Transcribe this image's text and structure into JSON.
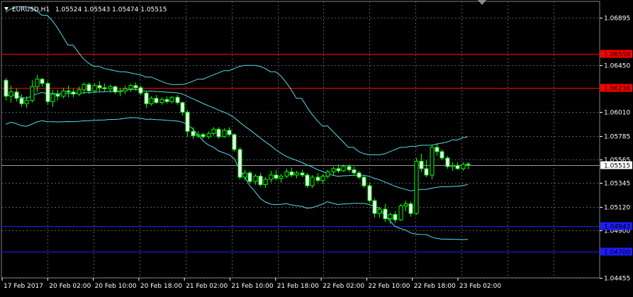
{
  "header": {
    "symbol_timeframe": "EURUSD,H1",
    "ohlc": "1.05524 1.05543 1.05474 1.05515",
    "menu_icon": "triangle-down-icon"
  },
  "price_axis": {
    "labels": [
      "1.06895",
      "1.06450",
      "1.06010",
      "1.05785",
      "1.05565",
      "1.05345",
      "1.05120",
      "1.04900",
      "1.04455"
    ],
    "values": [
      1.06895,
      1.0645,
      1.0601,
      1.05785,
      1.05565,
      1.05345,
      1.0512,
      1.049,
      1.04455
    ]
  },
  "time_axis": {
    "labels": [
      "17 Feb 2017",
      "20 Feb 02:00",
      "20 Feb 10:00",
      "20 Feb 18:00",
      "21 Feb 02:00",
      "21 Feb 10:00",
      "21 Feb 18:00",
      "22 Feb 02:00",
      "22 Feb 10:00",
      "22 Feb 18:00",
      "23 Feb 02:00"
    ]
  },
  "level_lines": [
    {
      "price": 1.06558,
      "label": "1.06558",
      "color": "#ff0000"
    },
    {
      "price": 1.06236,
      "label": "1.06236",
      "color": "#ff0000"
    },
    {
      "price": 1.04943,
      "label": "1.04943",
      "color": "#1c1cff"
    },
    {
      "price": 1.047,
      "label": "1.04700",
      "color": "#1c1cff"
    }
  ],
  "current_price": {
    "price": 1.05515,
    "label": "1.05515",
    "color": "#ffffff"
  },
  "colors": {
    "background": "#000000",
    "grid": "#5a5a5a",
    "candle_bull": "#000000",
    "candle_outline": "#00ff00",
    "bands": "#5ad8e8",
    "axis_text": "#ffffff"
  },
  "chart_data": {
    "type": "candlestick",
    "title": "EURUSD,H1",
    "y_range": [
      1.04455,
      1.0705
    ],
    "bollinger_bands": true,
    "grid": true,
    "candles": [
      [
        1.0631,
        1.0633,
        1.0612,
        1.0616
      ],
      [
        1.0616,
        1.0626,
        1.061,
        1.062
      ],
      [
        1.062,
        1.0623,
        1.0611,
        1.0614
      ],
      [
        1.0614,
        1.0618,
        1.0606,
        1.0609
      ],
      [
        1.0609,
        1.0616,
        1.0605,
        1.0612
      ],
      [
        1.0612,
        1.0631,
        1.061,
        1.0625
      ],
      [
        1.0625,
        1.0636,
        1.062,
        1.0632
      ],
      [
        1.0632,
        1.0633,
        1.0625,
        1.0628
      ],
      [
        1.0628,
        1.063,
        1.0608,
        1.0611
      ],
      [
        1.0611,
        1.0622,
        1.0606,
        1.0618
      ],
      [
        1.0618,
        1.0622,
        1.0612,
        1.0616
      ],
      [
        1.0616,
        1.0624,
        1.0614,
        1.0621
      ],
      [
        1.0621,
        1.0626,
        1.0615,
        1.062
      ],
      [
        1.062,
        1.0623,
        1.0615,
        1.0618
      ],
      [
        1.0618,
        1.0625,
        1.0616,
        1.0622
      ],
      [
        1.0622,
        1.0629,
        1.0618,
        1.0627
      ],
      [
        1.0627,
        1.0629,
        1.0618,
        1.0621
      ],
      [
        1.0621,
        1.0628,
        1.0619,
        1.0626
      ],
      [
        1.0626,
        1.063,
        1.062,
        1.0624
      ],
      [
        1.0624,
        1.0628,
        1.062,
        1.0623
      ],
      [
        1.0623,
        1.0627,
        1.0619,
        1.0625
      ],
      [
        1.0625,
        1.0626,
        1.0618,
        1.062
      ],
      [
        1.062,
        1.0624,
        1.0616,
        1.0621
      ],
      [
        1.0621,
        1.0626,
        1.0618,
        1.0623
      ],
      [
        1.0623,
        1.0628,
        1.062,
        1.0626
      ],
      [
        1.0626,
        1.0629,
        1.0621,
        1.0624
      ],
      [
        1.0624,
        1.0626,
        1.0617,
        1.0619
      ],
      [
        1.0619,
        1.0621,
        1.0605,
        1.0609
      ],
      [
        1.0609,
        1.0616,
        1.0607,
        1.0614
      ],
      [
        1.0614,
        1.0617,
        1.0609,
        1.061
      ],
      [
        1.061,
        1.0615,
        1.0608,
        1.0613
      ],
      [
        1.0613,
        1.0616,
        1.0609,
        1.0611
      ],
      [
        1.0611,
        1.0616,
        1.0609,
        1.0615
      ],
      [
        1.0615,
        1.0617,
        1.0608,
        1.061
      ],
      [
        1.061,
        1.0611,
        1.0598,
        1.0601
      ],
      [
        1.0601,
        1.0603,
        1.0578,
        1.0583
      ],
      [
        1.0583,
        1.0587,
        1.0576,
        1.0579
      ],
      [
        1.0579,
        1.0583,
        1.0577,
        1.058
      ],
      [
        1.058,
        1.0582,
        1.0576,
        1.0578
      ],
      [
        1.0578,
        1.0583,
        1.0576,
        1.0581
      ],
      [
        1.0581,
        1.0587,
        1.0579,
        1.0585
      ],
      [
        1.0585,
        1.0587,
        1.0576,
        1.0578
      ],
      [
        1.0578,
        1.0586,
        1.0577,
        1.0584
      ],
      [
        1.0584,
        1.0587,
        1.0578,
        1.058
      ],
      [
        1.058,
        1.0581,
        1.0564,
        1.0566
      ],
      [
        1.0566,
        1.0568,
        1.0538,
        1.054
      ],
      [
        1.054,
        1.0547,
        1.0537,
        1.0544
      ],
      [
        1.0544,
        1.0546,
        1.0534,
        1.0536
      ],
      [
        1.0536,
        1.0543,
        1.0533,
        1.0541
      ],
      [
        1.0541,
        1.0544,
        1.0531,
        1.0533
      ],
      [
        1.0533,
        1.054,
        1.053,
        1.0538
      ],
      [
        1.0538,
        1.0546,
        1.0535,
        1.0542
      ],
      [
        1.0542,
        1.0547,
        1.0537,
        1.0539
      ],
      [
        1.0539,
        1.0543,
        1.0535,
        1.0541
      ],
      [
        1.0541,
        1.0548,
        1.0539,
        1.0545
      ],
      [
        1.0545,
        1.0549,
        1.054,
        1.0542
      ],
      [
        1.0542,
        1.0546,
        1.0539,
        1.0544
      ],
      [
        1.0544,
        1.0547,
        1.054,
        1.0542
      ],
      [
        1.0542,
        1.0544,
        1.053,
        1.0532
      ],
      [
        1.0532,
        1.0542,
        1.053,
        1.054
      ],
      [
        1.054,
        1.0544,
        1.0535,
        1.0537
      ],
      [
        1.0537,
        1.0543,
        1.0534,
        1.0541
      ],
      [
        1.0541,
        1.0547,
        1.0539,
        1.0545
      ],
      [
        1.0545,
        1.055,
        1.0542,
        1.0548
      ],
      [
        1.0548,
        1.0552,
        1.0544,
        1.0546
      ],
      [
        1.0546,
        1.0552,
        1.0545,
        1.055
      ],
      [
        1.055,
        1.0552,
        1.0545,
        1.0547
      ],
      [
        1.0547,
        1.055,
        1.0542,
        1.0544
      ],
      [
        1.0544,
        1.0546,
        1.0538,
        1.054
      ],
      [
        1.054,
        1.0542,
        1.053,
        1.0532
      ],
      [
        1.0532,
        1.0534,
        1.0516,
        1.0518
      ],
      [
        1.0518,
        1.052,
        1.0502,
        1.0506
      ],
      [
        1.0506,
        1.0512,
        1.0502,
        1.051
      ],
      [
        1.051,
        1.0515,
        1.0498,
        1.0501
      ],
      [
        1.0501,
        1.0507,
        1.0496,
        1.0505
      ],
      [
        1.0505,
        1.0508,
        1.0497,
        1.05
      ],
      [
        1.05,
        1.0515,
        1.0499,
        1.0513
      ],
      [
        1.0513,
        1.0518,
        1.0508,
        1.0515
      ],
      [
        1.0515,
        1.0517,
        1.0503,
        1.0506
      ],
      [
        1.0506,
        1.0558,
        1.0505,
        1.0555
      ],
      [
        1.0555,
        1.0562,
        1.0545,
        1.0548
      ],
      [
        1.0548,
        1.0556,
        1.054,
        1.0542
      ],
      [
        1.0542,
        1.057,
        1.0538,
        1.0568
      ],
      [
        1.0568,
        1.0572,
        1.056,
        1.0564
      ],
      [
        1.0564,
        1.0566,
        1.0556,
        1.0558
      ],
      [
        1.0558,
        1.056,
        1.0548,
        1.055
      ],
      [
        1.055,
        1.0554,
        1.0546,
        1.0551
      ],
      [
        1.0551,
        1.0554,
        1.0547,
        1.0548
      ],
      [
        1.0548,
        1.0554,
        1.0546,
        1.0552
      ],
      [
        1.05524,
        1.05543,
        1.05474,
        1.05515
      ]
    ],
    "upper_band": [
      1.0695,
      1.0698,
      1.07,
      1.07,
      1.0699,
      1.0696,
      1.0692,
      1.0687,
      1.068,
      1.0672,
      1.0664,
      1.0657,
      1.0651,
      1.0647,
      1.0644,
      1.0642,
      1.0641,
      1.064,
      1.0639,
      1.0638,
      1.0637,
      1.0636,
      1.0634,
      1.0632,
      1.063,
      1.0628,
      1.0627,
      1.0627,
      1.0628,
      1.063,
      1.0632,
      1.0634,
      1.0636,
      1.0638,
      1.064,
      1.0642,
      1.0644,
      1.0645,
      1.0645,
      1.0644,
      1.0642,
      1.0639,
      1.0635,
      1.0629,
      1.0622,
      1.0614,
      1.0606,
      1.0599,
      1.0593,
      1.0588,
      1.0583,
      1.0578,
      1.0573,
      1.0568,
      1.0564,
      1.0562,
      1.0561,
      1.0561,
      1.0562,
      1.0564,
      1.0566,
      1.0568,
      1.0569,
      1.0569,
      1.057,
      1.057,
      1.0571,
      1.0572,
      1.0573,
      1.0575,
      1.0577,
      1.0578
    ]
  }
}
